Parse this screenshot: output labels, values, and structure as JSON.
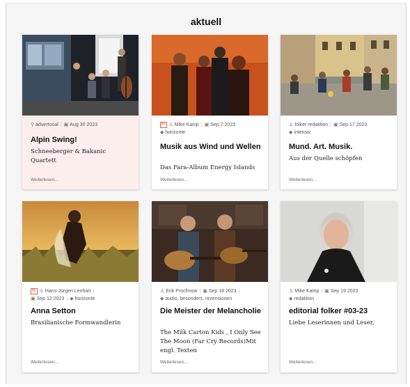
{
  "page": {
    "title": "aktuell"
  },
  "more_label": "Weiterlesen...",
  "cards": [
    {
      "title": "Alpin Swing!",
      "subtitle": "Schneeberger & Bakanic Quartett",
      "author": "advertorial",
      "date": "Aug 30 2023",
      "author_icon": "pin-icon"
    },
    {
      "badge": "f+",
      "author": "Mike Kamp",
      "date": "Sep 7 2023",
      "tags": "horizonte",
      "title": "Musik aus Wind und Wellen",
      "subtitle": "Das Fara-Album Energy Islands"
    },
    {
      "author": "folker redaktion",
      "date": "Sep 17 2023",
      "tags": "intensiv",
      "title": "Mund. Art. Musik.",
      "subtitle": "Aus der Quelle schöpfen"
    },
    {
      "badge": "f+",
      "author": "Hans-Jürgen Lenhart",
      "date": "Sep 12 2023",
      "tags": "horizonte",
      "title": "Anna Setton",
      "subtitle": "Brasilianische Formwandlerin"
    },
    {
      "author": "Erik Prochnow",
      "date": "Sep 18 2023",
      "tags": "audio, besonders, rezensionen",
      "title": "Die Meister der Melancholie",
      "subtitle": "The Milk Carton Kids , I Only See The Moon (Far Cry Records)Mit engl. Texten"
    },
    {
      "author": "Mike Kamp",
      "date": "Sep 19 2023",
      "tags": "redaktion",
      "title": "editorial folker #03-23",
      "subtitle": "Liebe Leserinnen und Leser,"
    }
  ],
  "colors": {
    "badge": "#e0603d",
    "advertorial_bg": "#fdeeee"
  }
}
